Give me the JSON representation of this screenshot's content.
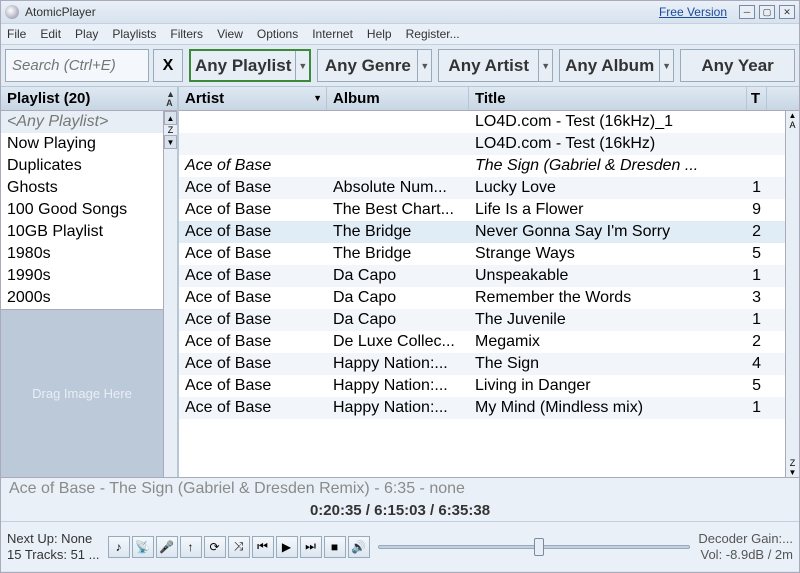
{
  "window": {
    "title": "AtomicPlayer",
    "free_label": "Free Version"
  },
  "menu": [
    "File",
    "Edit",
    "Play",
    "Playlists",
    "Filters",
    "View",
    "Options",
    "Internet",
    "Help",
    "Register..."
  ],
  "search": {
    "placeholder": "Search (Ctrl+E)",
    "clear": "X"
  },
  "filters": [
    {
      "label": "Any Playlist",
      "active": true
    },
    {
      "label": "Any Genre",
      "active": false
    },
    {
      "label": "Any Artist",
      "active": false
    },
    {
      "label": "Any Album",
      "active": false
    },
    {
      "label": "Any Year",
      "active": false
    }
  ],
  "sidebar": {
    "header": "Playlist (20)",
    "items": [
      "<Any Playlist>",
      "Now Playing",
      "Duplicates",
      "Ghosts",
      "100 Good Songs",
      "10GB Playlist",
      "1980s",
      "1990s",
      "2000s"
    ],
    "drag_label": "Drag Image Here"
  },
  "columns": {
    "artist": "Artist",
    "album": "Album",
    "title": "Title",
    "t": "T"
  },
  "rows": [
    {
      "artist": "",
      "album": "",
      "title": "LO4D.com - Test (16kHz)_1",
      "t": "",
      "italic": false
    },
    {
      "artist": "",
      "album": "",
      "title": "LO4D.com - Test (16kHz)",
      "t": "",
      "italic": false
    },
    {
      "artist": "Ace of Base",
      "album": "",
      "title": "The Sign (Gabriel & Dresden ...",
      "t": "",
      "italic": true
    },
    {
      "artist": "Ace of Base",
      "album": "Absolute Num...",
      "title": "Lucky Love",
      "t": "1",
      "italic": false
    },
    {
      "artist": "Ace of Base",
      "album": "The Best Chart...",
      "title": "Life Is a Flower",
      "t": "9",
      "italic": false
    },
    {
      "artist": "Ace of Base",
      "album": "The Bridge",
      "title": "Never Gonna Say I'm Sorry",
      "t": "2",
      "italic": false,
      "hl": true
    },
    {
      "artist": "Ace of Base",
      "album": "The Bridge",
      "title": "Strange Ways",
      "t": "5",
      "italic": false
    },
    {
      "artist": "Ace of Base",
      "album": "Da Capo",
      "title": "Unspeakable",
      "t": "1",
      "italic": false
    },
    {
      "artist": "Ace of Base",
      "album": "Da Capo",
      "title": "Remember the Words",
      "t": "3",
      "italic": false
    },
    {
      "artist": "Ace of Base",
      "album": "Da Capo",
      "title": "The Juvenile",
      "t": "1",
      "italic": false
    },
    {
      "artist": "Ace of Base",
      "album": "De Luxe Collec...",
      "title": "Megamix",
      "t": "2",
      "italic": false
    },
    {
      "artist": "Ace of Base",
      "album": "Happy Nation:...",
      "title": "The Sign",
      "t": "4",
      "italic": false
    },
    {
      "artist": "Ace of Base",
      "album": "Happy Nation:...",
      "title": "Living in Danger",
      "t": "5",
      "italic": false
    },
    {
      "artist": "Ace of Base",
      "album": "Happy Nation:...",
      "title": "My Mind (Mindless mix)",
      "t": "1",
      "italic": false
    }
  ],
  "nowplaying": "Ace of Base - The Sign (Gabriel & Dresden Remix) - 6:35 - none",
  "times": "0:20:35  /  6:15:03  /  6:35:38",
  "footer": {
    "next_up": "Next Up: None",
    "tracks": "15 Tracks: 51 ...",
    "decoder": "Decoder Gain:...",
    "vol": "Vol: -8.9dB / 2m"
  }
}
